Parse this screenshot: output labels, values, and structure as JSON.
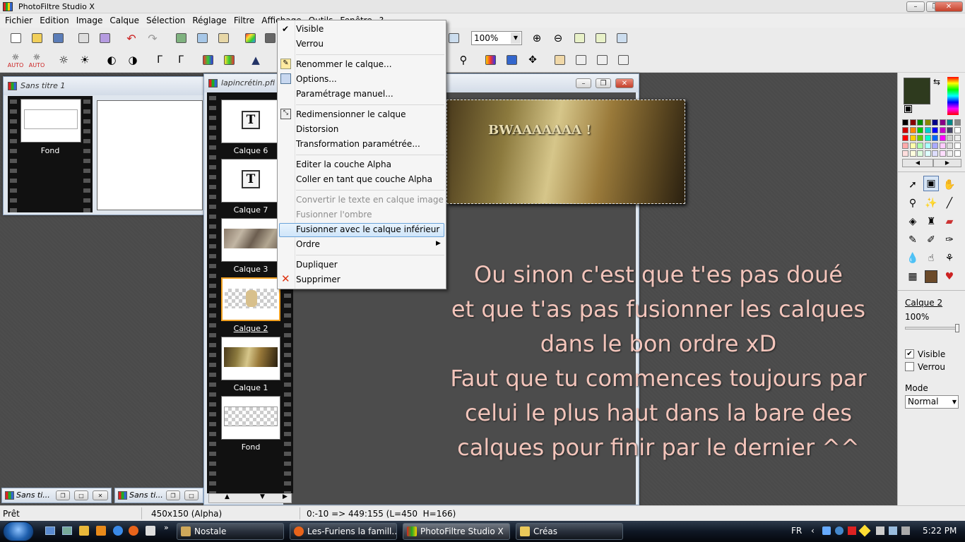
{
  "app": {
    "title": "PhotoFiltre Studio X"
  },
  "window_controls": {
    "minimize": "–",
    "maximize": "❐",
    "close": "✕"
  },
  "menubar": [
    "Fichier",
    "Edition",
    "Image",
    "Calque",
    "Sélection",
    "Réglage",
    "Filtre",
    "Affichage",
    "Outils",
    "Fenêtre",
    "?"
  ],
  "toolbar": {
    "zoom_value": "100%",
    "auto_label": "AUTO"
  },
  "doc1": {
    "title": "Sans titre 1",
    "layer_label": "Fond"
  },
  "doc2": {
    "title": "lapincrétin.pfi",
    "layers": [
      {
        "label": "Calque 6"
      },
      {
        "label": "Calque 7"
      },
      {
        "label": "Calque 3"
      },
      {
        "label": "Calque 2"
      },
      {
        "label": "Calque 1"
      },
      {
        "label": "Fond"
      }
    ],
    "canvas_text": "BWAAAAAAA !"
  },
  "context_menu": {
    "items": [
      {
        "label": "Visible",
        "checked": true
      },
      {
        "label": "Verrou"
      },
      {
        "label": "Renommer le calque..."
      },
      {
        "label": "Options..."
      },
      {
        "label": "Paramétrage manuel..."
      },
      {
        "label": "Redimensionner le calque"
      },
      {
        "label": "Distorsion"
      },
      {
        "label": "Transformation paramétrée..."
      },
      {
        "label": "Editer la couche Alpha"
      },
      {
        "label": "Coller en tant que couche Alpha"
      },
      {
        "label": "Convertir le texte en calque image",
        "disabled": true
      },
      {
        "label": "Fusionner l'ombre",
        "disabled": true
      },
      {
        "label": "Fusionner avec le calque inférieur",
        "highlighted": true
      },
      {
        "label": "Ordre",
        "submenu": true
      },
      {
        "label": "Dupliquer"
      },
      {
        "label": "Supprimer"
      }
    ]
  },
  "overlay_text": [
    "Ou sinon c'est que t'es pas doué",
    "et que t'as pas fusionner les calques",
    "dans le bon ordre xD",
    "Faut que tu commences toujours par",
    "celui le plus haut dans la bare des",
    "calques pour finir par le dernier ^^"
  ],
  "layer_panel": {
    "name": "Calque 2",
    "opacity": "100%",
    "visible_label": "Visible",
    "lock_label": "Verrou",
    "mode_label": "Mode",
    "mode_value": "Normal",
    "foreground_color": "#2e3a1e"
  },
  "minimized": [
    {
      "label": "Sans ti..."
    },
    {
      "label": "Sans ti..."
    }
  ],
  "status": {
    "ready": "Prêt",
    "size": "450x150 (Alpha)",
    "coords": "0:-10 => 449:155 (L=450  H=166)"
  },
  "taskbar": {
    "tasks": [
      {
        "label": "Nostale"
      },
      {
        "label": "Les-Furiens la famill..."
      },
      {
        "label": "PhotoFiltre Studio X"
      },
      {
        "label": "Créas"
      }
    ],
    "lang": "FR",
    "clock": "5:22 PM"
  }
}
